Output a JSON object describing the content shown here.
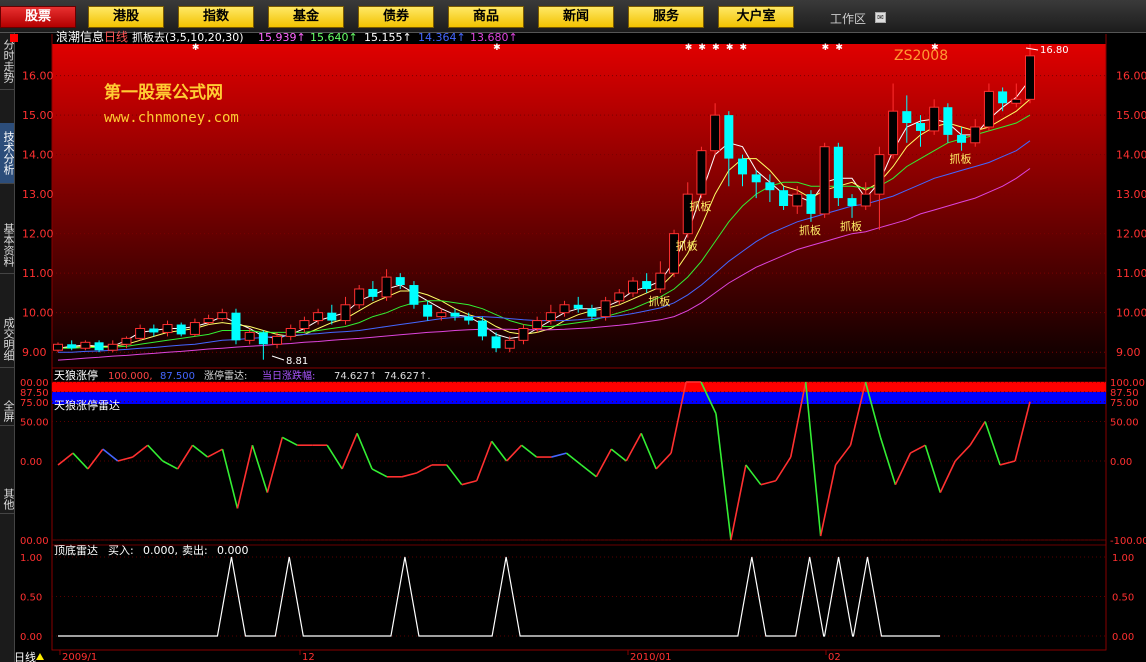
{
  "nav": [
    {
      "label": "股票",
      "active": true
    },
    {
      "label": "港股"
    },
    {
      "label": "指数"
    },
    {
      "label": "基金"
    },
    {
      "label": "债券"
    },
    {
      "label": "商品"
    },
    {
      "label": "新闻"
    },
    {
      "label": "服务"
    },
    {
      "label": "大户室"
    }
  ],
  "workspace_label": "工作区",
  "sidebar": [
    {
      "label": "分时走势"
    },
    {
      "label": "技术分析",
      "active": true
    },
    {
      "label": "基本资料"
    },
    {
      "label": "成交明细"
    },
    {
      "label": "全屏"
    },
    {
      "label": "其他"
    }
  ],
  "main_panel": {
    "name": "浪潮信息",
    "period": "日线",
    "indicator": "抓板去(3,5,10,20,30)",
    "ma_values": [
      "15.939↑",
      "15.640↑",
      "15.155↑",
      "14.364↑",
      "13.680↑"
    ],
    "watermark_cn": "第一股票公式网",
    "watermark_url": "www.chnmoney.com",
    "badge": "ZS2008",
    "high_label": "16.80",
    "low_label": "8.81",
    "signal_label": "抓板",
    "y_ticks": [
      "16.00",
      "15.00",
      "14.00",
      "13.00",
      "12.00",
      "11.00",
      "10.00",
      "9.00"
    ]
  },
  "radar_panel": {
    "title": "天狼涨停",
    "v1": "100.000,",
    "v2": "87.500",
    "sub": "涨停雷达:",
    "sub2": "当日涨跌幅:",
    "v3": "74.627↑",
    "v4": "74.627↑.",
    "inner_label": "天狼涨停雷达",
    "y_ticks_left": [
      "00.00",
      "87.50",
      "75.00",
      "50.00",
      "0.00",
      "00.00"
    ],
    "y_ticks_right": [
      "100.00",
      "87.50",
      "75.00",
      "50.00",
      "0.00",
      "-100.00"
    ]
  },
  "bottom_panel": {
    "title": "顶底雷达",
    "buy_label": "买入:",
    "buy_value": "0.000,",
    "sell_label": "卖出:",
    "sell_value": "0.000",
    "y_ticks": [
      "1.00",
      "0.50",
      "0.00"
    ]
  },
  "x_axis": {
    "period_label": "日线",
    "dates": [
      "2009/1",
      "12",
      "2010/01",
      "02"
    ]
  },
  "colors": {
    "accent": "#ff0000",
    "up": "#ff3030",
    "down": "#00ffff",
    "green": "#33ee33"
  },
  "chart_data": [
    {
      "type": "candlestick",
      "title": "浪潮信息",
      "ylim": [
        8.6,
        16.8
      ],
      "candles": [
        [
          9.05,
          9.2,
          9.25,
          9.0
        ],
        [
          9.2,
          9.1,
          9.3,
          9.05
        ],
        [
          9.1,
          9.25,
          9.3,
          9.05
        ],
        [
          9.25,
          9.05,
          9.3,
          9.0
        ],
        [
          9.05,
          9.2,
          9.3,
          9.0
        ],
        [
          9.2,
          9.35,
          9.4,
          9.1
        ],
        [
          9.35,
          9.6,
          9.7,
          9.3
        ],
        [
          9.6,
          9.5,
          9.7,
          9.4
        ],
        [
          9.5,
          9.7,
          9.8,
          9.4
        ],
        [
          9.7,
          9.45,
          9.75,
          9.4
        ],
        [
          9.45,
          9.75,
          9.85,
          9.4
        ],
        [
          9.75,
          9.85,
          9.95,
          9.7
        ],
        [
          9.85,
          10.0,
          10.1,
          9.8
        ],
        [
          10.0,
          9.3,
          10.1,
          9.2
        ],
        [
          9.3,
          9.5,
          9.6,
          9.2
        ],
        [
          9.5,
          9.2,
          9.55,
          8.81
        ],
        [
          9.2,
          9.4,
          9.5,
          9.1
        ],
        [
          9.4,
          9.6,
          9.7,
          9.3
        ],
        [
          9.6,
          9.8,
          9.9,
          9.5
        ],
        [
          9.8,
          10.0,
          10.1,
          9.7
        ],
        [
          10.0,
          9.8,
          10.2,
          9.7
        ],
        [
          9.8,
          10.2,
          10.4,
          9.7
        ],
        [
          10.2,
          10.6,
          10.7,
          10.1
        ],
        [
          10.6,
          10.4,
          10.8,
          10.3
        ],
        [
          10.4,
          10.9,
          11.1,
          10.3
        ],
        [
          10.9,
          10.7,
          11.0,
          10.6
        ],
        [
          10.7,
          10.2,
          10.8,
          10.1
        ],
        [
          10.2,
          9.9,
          10.3,
          9.8
        ],
        [
          9.9,
          10.0,
          10.1,
          9.8
        ],
        [
          10.0,
          9.9,
          10.1,
          9.8
        ],
        [
          9.9,
          9.8,
          10.0,
          9.7
        ],
        [
          9.8,
          9.4,
          9.9,
          9.3
        ],
        [
          9.4,
          9.1,
          9.5,
          9.0
        ],
        [
          9.1,
          9.3,
          9.4,
          9.0
        ],
        [
          9.3,
          9.6,
          9.7,
          9.2
        ],
        [
          9.6,
          9.8,
          9.9,
          9.5
        ],
        [
          9.8,
          10.0,
          10.2,
          9.7
        ],
        [
          10.0,
          10.2,
          10.3,
          9.9
        ],
        [
          10.2,
          10.1,
          10.4,
          10.0
        ],
        [
          10.1,
          9.9,
          10.2,
          9.8
        ],
        [
          9.9,
          10.3,
          10.4,
          9.8
        ],
        [
          10.3,
          10.5,
          10.6,
          10.2
        ],
        [
          10.5,
          10.8,
          10.9,
          10.4
        ],
        [
          10.8,
          10.6,
          11.0,
          10.5
        ],
        [
          10.6,
          11.0,
          11.3,
          10.5
        ],
        [
          11.0,
          12.0,
          12.1,
          10.9
        ],
        [
          12.0,
          13.0,
          13.3,
          11.9
        ],
        [
          13.0,
          14.1,
          14.2,
          12.9
        ],
        [
          14.1,
          15.0,
          15.3,
          14.0
        ],
        [
          15.0,
          13.9,
          15.1,
          13.2
        ],
        [
          13.9,
          13.5,
          14.0,
          13.2
        ],
        [
          13.5,
          13.3,
          13.6,
          12.9
        ],
        [
          13.3,
          13.1,
          13.5,
          12.8
        ],
        [
          13.1,
          12.7,
          13.2,
          12.6
        ],
        [
          12.7,
          13.0,
          13.2,
          12.5
        ],
        [
          13.0,
          12.5,
          13.1,
          12.3
        ],
        [
          12.5,
          14.2,
          14.3,
          12.4
        ],
        [
          14.2,
          12.9,
          14.3,
          12.7
        ],
        [
          12.9,
          12.7,
          13.0,
          12.4
        ],
        [
          12.7,
          13.0,
          13.3,
          12.6
        ],
        [
          13.0,
          14.0,
          14.2,
          12.1
        ],
        [
          14.0,
          15.1,
          15.8,
          13.9
        ],
        [
          15.1,
          14.8,
          15.5,
          14.3
        ],
        [
          14.8,
          14.6,
          15.0,
          14.2
        ],
        [
          14.6,
          15.2,
          15.4,
          14.5
        ],
        [
          15.2,
          14.5,
          15.3,
          14.3
        ],
        [
          14.5,
          14.3,
          14.7,
          14.1
        ],
        [
          14.3,
          14.7,
          14.9,
          14.2
        ],
        [
          14.7,
          15.6,
          15.8,
          14.6
        ],
        [
          15.6,
          15.3,
          15.7,
          15.1
        ],
        [
          15.3,
          15.4,
          15.8,
          15.2
        ],
        [
          15.4,
          16.5,
          16.8,
          15.3
        ]
      ],
      "ma_series": [
        {
          "name": "MA3",
          "color": "#ffffff",
          "values": [
            9.1,
            9.15,
            9.18,
            9.15,
            9.15,
            9.3,
            9.5,
            9.55,
            9.6,
            9.6,
            9.65,
            9.75,
            9.9,
            9.75,
            9.6,
            9.4,
            9.35,
            9.45,
            9.6,
            9.8,
            9.9,
            10.0,
            10.3,
            10.45,
            10.6,
            10.7,
            10.5,
            10.3,
            10.1,
            9.95,
            9.9,
            9.7,
            9.45,
            9.35,
            9.4,
            9.6,
            9.8,
            10.0,
            10.1,
            10.1,
            10.15,
            10.3,
            10.55,
            10.65,
            10.8,
            11.3,
            12.0,
            13.0,
            14.0,
            14.3,
            14.2,
            13.6,
            13.3,
            13.0,
            12.95,
            12.8,
            13.3,
            13.4,
            13.4,
            12.9,
            13.3,
            14.1,
            14.7,
            14.85,
            14.9,
            14.8,
            14.5,
            14.5,
            14.9,
            15.2,
            15.45,
            15.9
          ]
        },
        {
          "name": "MA5",
          "color": "#ffff66",
          "values": [
            9.1,
            9.12,
            9.15,
            9.14,
            9.15,
            9.2,
            9.3,
            9.4,
            9.5,
            9.55,
            9.6,
            9.7,
            9.75,
            9.7,
            9.65,
            9.55,
            9.45,
            9.4,
            9.45,
            9.6,
            9.75,
            9.85,
            10.05,
            10.25,
            10.4,
            10.55,
            10.55,
            10.45,
            10.3,
            10.1,
            9.95,
            9.85,
            9.65,
            9.5,
            9.45,
            9.5,
            9.6,
            9.8,
            9.95,
            10.05,
            10.1,
            10.2,
            10.35,
            10.5,
            10.65,
            11.0,
            11.5,
            12.2,
            13.0,
            13.6,
            13.9,
            13.9,
            13.6,
            13.2,
            13.1,
            12.9,
            13.1,
            13.2,
            13.3,
            13.1,
            13.3,
            13.7,
            14.2,
            14.5,
            14.7,
            14.8,
            14.7,
            14.6,
            14.7,
            14.9,
            15.1,
            15.4
          ]
        },
        {
          "name": "MA10",
          "color": "#33ee33",
          "values": [
            9.1,
            9.1,
            9.12,
            9.12,
            9.13,
            9.15,
            9.2,
            9.25,
            9.3,
            9.35,
            9.4,
            9.45,
            9.55,
            9.55,
            9.55,
            9.5,
            9.5,
            9.5,
            9.5,
            9.55,
            9.6,
            9.65,
            9.75,
            9.9,
            10.0,
            10.15,
            10.25,
            10.3,
            10.3,
            10.25,
            10.2,
            10.1,
            9.95,
            9.8,
            9.7,
            9.65,
            9.65,
            9.7,
            9.75,
            9.8,
            9.9,
            10.0,
            10.1,
            10.25,
            10.4,
            10.6,
            10.9,
            11.3,
            11.8,
            12.3,
            12.7,
            13.0,
            13.2,
            13.3,
            13.3,
            13.2,
            13.2,
            13.2,
            13.2,
            13.15,
            13.2,
            13.4,
            13.7,
            13.9,
            14.1,
            14.3,
            14.4,
            14.5,
            14.6,
            14.7,
            14.8,
            15.0
          ]
        },
        {
          "name": "MA20",
          "color": "#4466ff",
          "values": [
            9.0,
            9.0,
            9.02,
            9.03,
            9.05,
            9.07,
            9.1,
            9.12,
            9.15,
            9.18,
            9.2,
            9.25,
            9.3,
            9.32,
            9.35,
            9.37,
            9.4,
            9.42,
            9.45,
            9.47,
            9.5,
            9.52,
            9.55,
            9.6,
            9.65,
            9.7,
            9.75,
            9.8,
            9.85,
            9.88,
            9.9,
            9.9,
            9.88,
            9.85,
            9.82,
            9.8,
            9.8,
            9.8,
            9.82,
            9.85,
            9.88,
            9.92,
            9.98,
            10.05,
            10.12,
            10.25,
            10.45,
            10.7,
            11.0,
            11.3,
            11.55,
            11.8,
            12.0,
            12.15,
            12.3,
            12.4,
            12.5,
            12.6,
            12.7,
            12.75,
            12.85,
            12.95,
            13.1,
            13.25,
            13.4,
            13.5,
            13.6,
            13.7,
            13.8,
            13.95,
            14.1,
            14.35
          ]
        },
        {
          "name": "MA30",
          "color": "#dd44dd",
          "values": [
            8.8,
            8.82,
            8.85,
            8.87,
            8.9,
            8.92,
            8.95,
            8.97,
            9.0,
            9.02,
            9.05,
            9.08,
            9.1,
            9.13,
            9.15,
            9.17,
            9.2,
            9.22,
            9.25,
            9.27,
            9.3,
            9.33,
            9.35,
            9.38,
            9.41,
            9.44,
            9.47,
            9.5,
            9.52,
            9.55,
            9.57,
            9.58,
            9.58,
            9.58,
            9.57,
            9.57,
            9.57,
            9.58,
            9.6,
            9.62,
            9.65,
            9.68,
            9.72,
            9.77,
            9.82,
            9.9,
            10.05,
            10.25,
            10.5,
            10.75,
            10.95,
            11.15,
            11.3,
            11.45,
            11.6,
            11.7,
            11.8,
            11.9,
            12.0,
            12.05,
            12.15,
            12.25,
            12.35,
            12.5,
            12.6,
            12.7,
            12.8,
            12.9,
            13.05,
            13.2,
            13.4,
            13.65
          ]
        }
      ],
      "signals": [
        {
          "index": 44,
          "label": "抓板"
        },
        {
          "index": 46,
          "label": "抓板"
        },
        {
          "index": 47,
          "label": "抓板"
        },
        {
          "index": 55,
          "label": "抓板"
        },
        {
          "index": 58,
          "label": "抓板"
        },
        {
          "index": 66,
          "label": "抓板"
        }
      ]
    },
    {
      "type": "line",
      "title": "天狼涨停",
      "ylim": [
        -100,
        100
      ],
      "x": [
        0,
        1,
        2,
        3,
        4,
        5,
        6,
        7,
        8,
        9,
        10,
        11,
        12,
        13,
        14,
        15,
        16,
        17,
        18,
        19,
        20,
        21,
        22,
        23,
        24,
        25,
        26,
        27,
        28,
        29,
        30,
        31,
        32,
        33,
        34,
        35,
        36,
        37,
        38,
        39,
        40,
        41,
        42,
        43,
        44,
        45,
        46,
        47,
        48,
        49,
        50,
        51,
        52,
        53,
        54,
        55,
        56,
        57,
        58,
        59,
        60,
        61,
        62,
        63,
        64,
        65,
        66,
        67,
        68,
        69,
        70
      ],
      "values": [
        -5,
        10,
        -10,
        15,
        0,
        5,
        20,
        0,
        -10,
        20,
        5,
        15,
        -60,
        20,
        -40,
        30,
        20,
        20,
        20,
        -10,
        35,
        -10,
        -20,
        -20,
        -15,
        -5,
        -5,
        -30,
        -25,
        25,
        0,
        20,
        5,
        5,
        10,
        -5,
        -20,
        15,
        0,
        35,
        -10,
        10,
        100,
        100,
        60,
        -100,
        -5,
        -30,
        -25,
        5,
        100,
        -95,
        -5,
        20,
        100,
        30,
        -30,
        10,
        20,
        -40,
        0,
        20,
        50,
        -5,
        0,
        75
      ],
      "colors": [
        "#ff3030",
        "#33ee33",
        "#4466ff"
      ]
    },
    {
      "type": "line",
      "title": "顶底雷达",
      "ylim": [
        0,
        1
      ],
      "spikes": [
        12,
        16,
        24,
        31,
        48,
        52,
        54,
        56
      ],
      "series": [
        {
          "name": "买入",
          "value": 0.0
        },
        {
          "name": "卖出",
          "value": 0.0
        }
      ]
    }
  ]
}
